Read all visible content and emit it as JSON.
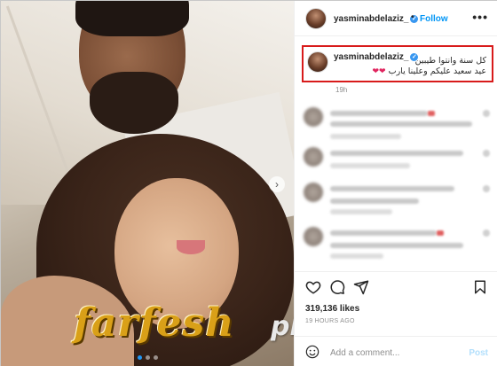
{
  "post": {
    "username": "yasminabdelaziz_",
    "follow_label": "Follow",
    "more_label": "•••",
    "verified_glyph": "✓"
  },
  "caption": {
    "username": "yasminabdelaziz_",
    "line1": "كل سنة وانتوا طيبين",
    "line2": "عيد سعيد عليكم وعلينا يارب",
    "hearts": "❤❤",
    "time": "19h"
  },
  "stats": {
    "likes": "319,136 likes",
    "posted": "19 HOURS AGO"
  },
  "comment_input": {
    "placeholder": "Add a comment...",
    "post_label": "Post"
  },
  "watermark": {
    "brand": "farfesh",
    "suffix": "plus.com"
  },
  "carousel": {
    "next_glyph": "›",
    "slides": 3,
    "active_slide": 1
  },
  "icons": [
    "ellipsis-icon",
    "verified-badge-icon",
    "heart-icon",
    "comment-icon",
    "share-icon",
    "bookmark-icon",
    "emoji-icon",
    "chevron-right-icon"
  ],
  "colors": {
    "follow_blue": "#0095f6",
    "verified_blue": "#3897f0",
    "highlight_red": "#d81b1b",
    "heart_red": "#e0245e"
  }
}
